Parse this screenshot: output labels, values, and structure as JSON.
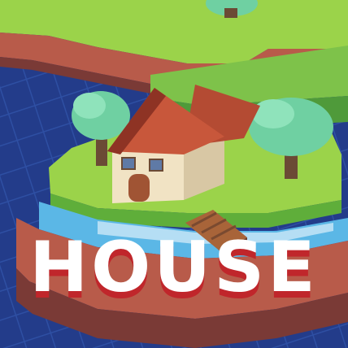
{
  "title": "HOUSE",
  "icons": {
    "trees": [
      "tree-icon",
      "tree-icon",
      "tree-icon"
    ],
    "house": "house-icon",
    "dock": "dock-icon"
  },
  "colors": {
    "water_deep": "#233c8a",
    "water_grid": "#2e4fa3",
    "grass_light": "#9bd34a",
    "grass_dark": "#5fae3a",
    "cliff_red": "#b85b4a",
    "cliff_dark": "#7a3a36",
    "roof": "#b44b33",
    "wall": "#f1e3c4",
    "tree": "#6fd0a2",
    "title_fill": "#ffffff",
    "title_shadow": "#c0262b"
  }
}
